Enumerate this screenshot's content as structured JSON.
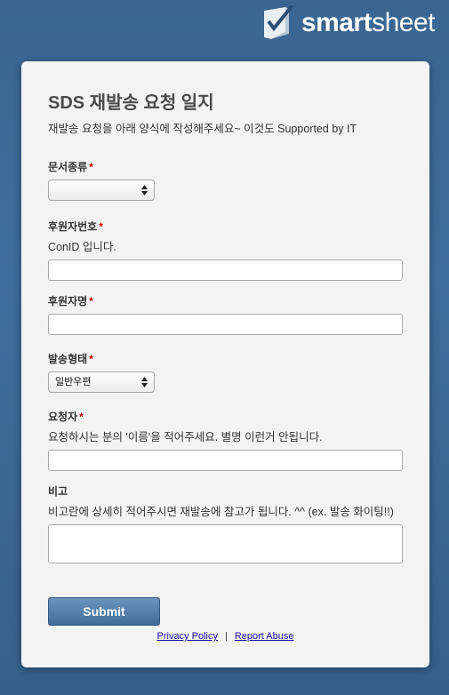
{
  "brand": {
    "logo_text_bold": "smart",
    "logo_text_light": "sheet",
    "logo_icon": "smartsheet-check-logo-icon"
  },
  "form": {
    "title": "SDS 재발송 요청 일지",
    "description": "재발송 요청을 아래 양식에 작성해주세요~ 이것도 Supported by IT",
    "required_mark": "*",
    "fields": {
      "doc_type": {
        "label": "문서종류",
        "selected": ""
      },
      "sponsor_no": {
        "label": "후원자번호",
        "hint": "ConID 입니다.",
        "value": ""
      },
      "sponsor_name": {
        "label": "후원자명",
        "value": ""
      },
      "send_type": {
        "label": "발송형태",
        "selected": "일반우편"
      },
      "requester": {
        "label": "요청자",
        "hint": "요청하시는 분의 '이름'을 적어주세요. 별명 이런거 안됩니다.",
        "value": ""
      },
      "notes": {
        "label": "비고",
        "hint": "비고란에 상세히 적어주시면 재발송에 참고가 됩니다. ^^ (ex. 발송 화이팅!!)",
        "value": ""
      }
    },
    "submit_label": "Submit"
  },
  "footer": {
    "privacy_label": "Privacy Policy",
    "separator": "|",
    "report_label": "Report Abuse"
  },
  "colors": {
    "background": "#3f6d9d",
    "card": "#f3f3f3",
    "submit": "#4f7ca7",
    "required": "#cc0000"
  }
}
